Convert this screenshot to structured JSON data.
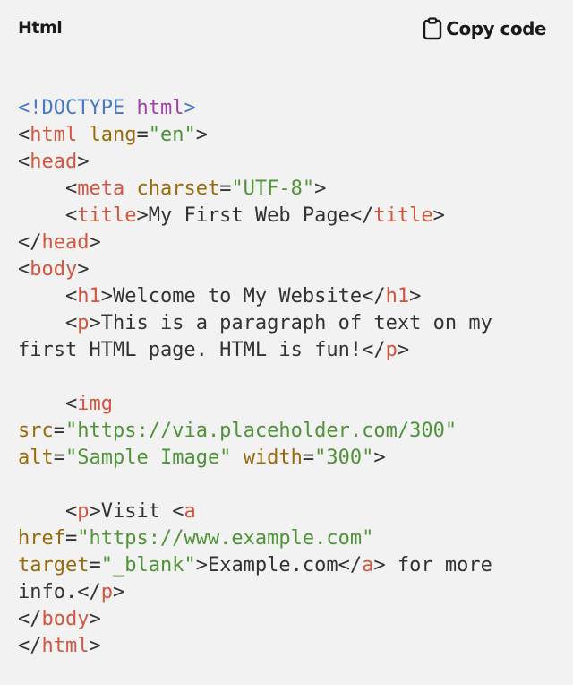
{
  "header": {
    "language": "Html",
    "copy_label": "Copy code",
    "copy_icon": "clipboard-icon"
  },
  "colors": {
    "doctype": "#4a78c2",
    "keyword": "#a23ea8",
    "tag": "#d2553f",
    "attribute": "#9a6a08",
    "string": "#4f9338",
    "text": "#333333",
    "background": "#f2f2f2"
  },
  "code": {
    "lines": [
      [
        {
          "t": "doc",
          "v": "<!DOCTYPE "
        },
        {
          "t": "kw",
          "v": "html"
        },
        {
          "t": "doc",
          "v": ">"
        }
      ],
      [
        {
          "t": "txt",
          "v": "<"
        },
        {
          "t": "tag",
          "v": "html"
        },
        {
          "t": "txt",
          "v": " "
        },
        {
          "t": "attr",
          "v": "lang"
        },
        {
          "t": "txt",
          "v": "="
        },
        {
          "t": "str",
          "v": "\"en\""
        },
        {
          "t": "txt",
          "v": ">"
        }
      ],
      [
        {
          "t": "txt",
          "v": "<"
        },
        {
          "t": "tag",
          "v": "head"
        },
        {
          "t": "txt",
          "v": ">"
        }
      ],
      [
        {
          "t": "txt",
          "v": "    <"
        },
        {
          "t": "tag",
          "v": "meta"
        },
        {
          "t": "txt",
          "v": " "
        },
        {
          "t": "attr",
          "v": "charset"
        },
        {
          "t": "txt",
          "v": "="
        },
        {
          "t": "str",
          "v": "\"UTF-8\""
        },
        {
          "t": "txt",
          "v": ">"
        }
      ],
      [
        {
          "t": "txt",
          "v": "    <"
        },
        {
          "t": "tag",
          "v": "title"
        },
        {
          "t": "txt",
          "v": ">My First Web Page</"
        },
        {
          "t": "tag",
          "v": "title"
        },
        {
          "t": "txt",
          "v": ">"
        }
      ],
      [
        {
          "t": "txt",
          "v": "</"
        },
        {
          "t": "tag",
          "v": "head"
        },
        {
          "t": "txt",
          "v": ">"
        }
      ],
      [
        {
          "t": "txt",
          "v": "<"
        },
        {
          "t": "tag",
          "v": "body"
        },
        {
          "t": "txt",
          "v": ">"
        }
      ],
      [
        {
          "t": "txt",
          "v": "    <"
        },
        {
          "t": "tag",
          "v": "h1"
        },
        {
          "t": "txt",
          "v": ">Welcome to My Website</"
        },
        {
          "t": "tag",
          "v": "h1"
        },
        {
          "t": "txt",
          "v": ">"
        }
      ],
      [
        {
          "t": "txt",
          "v": "    <"
        },
        {
          "t": "tag",
          "v": "p"
        },
        {
          "t": "txt",
          "v": ">This is a paragraph of text on my"
        }
      ],
      [
        {
          "t": "txt",
          "v": "first HTML page. HTML is fun!</"
        },
        {
          "t": "tag",
          "v": "p"
        },
        {
          "t": "txt",
          "v": ">"
        }
      ],
      [],
      [
        {
          "t": "txt",
          "v": "    <"
        },
        {
          "t": "tag",
          "v": "img"
        }
      ],
      [
        {
          "t": "attr",
          "v": "src"
        },
        {
          "t": "txt",
          "v": "="
        },
        {
          "t": "str",
          "v": "\"https://via.placeholder.com/300\""
        }
      ],
      [
        {
          "t": "attr",
          "v": "alt"
        },
        {
          "t": "txt",
          "v": "="
        },
        {
          "t": "str",
          "v": "\"Sample Image\""
        },
        {
          "t": "txt",
          "v": " "
        },
        {
          "t": "attr",
          "v": "width"
        },
        {
          "t": "txt",
          "v": "="
        },
        {
          "t": "str",
          "v": "\"300\""
        },
        {
          "t": "txt",
          "v": ">"
        }
      ],
      [],
      [
        {
          "t": "txt",
          "v": "    <"
        },
        {
          "t": "tag",
          "v": "p"
        },
        {
          "t": "txt",
          "v": ">Visit <"
        },
        {
          "t": "tag",
          "v": "a"
        }
      ],
      [
        {
          "t": "attr",
          "v": "href"
        },
        {
          "t": "txt",
          "v": "="
        },
        {
          "t": "str",
          "v": "\"https://www.example.com\""
        }
      ],
      [
        {
          "t": "attr",
          "v": "target"
        },
        {
          "t": "txt",
          "v": "="
        },
        {
          "t": "str",
          "v": "\"_blank\""
        },
        {
          "t": "txt",
          "v": ">Example.com</"
        },
        {
          "t": "tag",
          "v": "a"
        },
        {
          "t": "txt",
          "v": "> for more"
        }
      ],
      [
        {
          "t": "txt",
          "v": "info.</"
        },
        {
          "t": "tag",
          "v": "p"
        },
        {
          "t": "txt",
          "v": ">"
        }
      ],
      [
        {
          "t": "txt",
          "v": "</"
        },
        {
          "t": "tag",
          "v": "body"
        },
        {
          "t": "txt",
          "v": ">"
        }
      ],
      [
        {
          "t": "txt",
          "v": "</"
        },
        {
          "t": "tag",
          "v": "html"
        },
        {
          "t": "txt",
          "v": ">"
        }
      ]
    ]
  }
}
